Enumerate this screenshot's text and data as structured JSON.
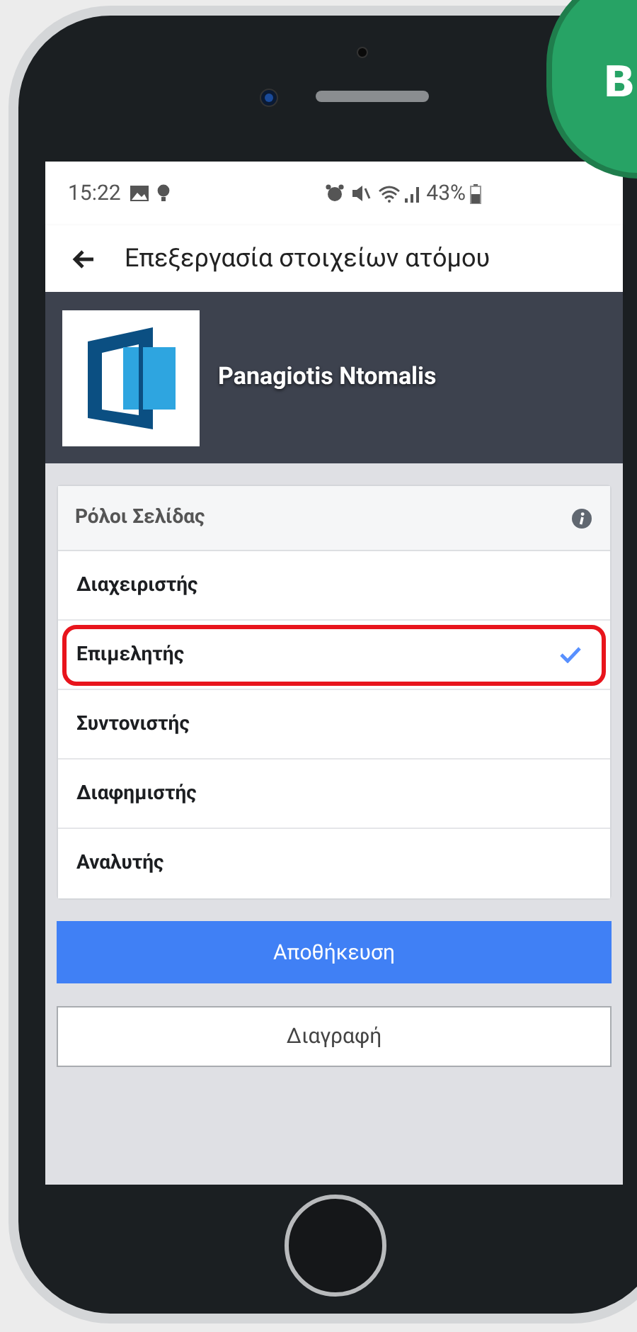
{
  "badge": {
    "text": "B"
  },
  "status_bar": {
    "time": "15:22",
    "battery": "43%"
  },
  "app_bar": {
    "title": "Επεξεργασία στοιχείων ατόμου"
  },
  "profile": {
    "name": "Panagiotis Ntomalis"
  },
  "roles": {
    "title": "Ρόλοι Σελίδας",
    "items": [
      {
        "label": "Διαχειριστής",
        "selected": false
      },
      {
        "label": "Επιμελητής",
        "selected": true
      },
      {
        "label": "Συντονιστής",
        "selected": false
      },
      {
        "label": "Διαφημιστής",
        "selected": false
      },
      {
        "label": "Αναλυτής",
        "selected": false
      }
    ]
  },
  "buttons": [
    {
      "label": "Αποθήκευση",
      "kind": "primary"
    },
    {
      "label": "Διαγραφή",
      "kind": "secondary"
    }
  ]
}
